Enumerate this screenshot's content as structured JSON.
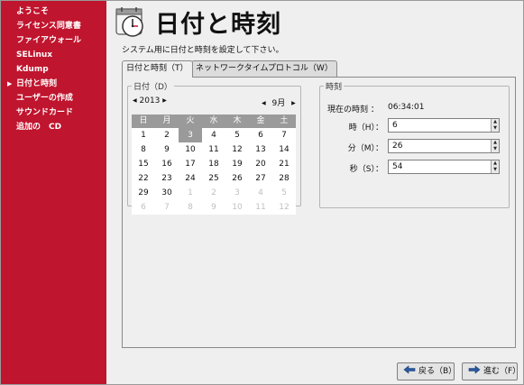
{
  "sidebar": {
    "items": [
      {
        "label": "ようこそ",
        "current": false
      },
      {
        "label": "ライセンス同意書",
        "current": false
      },
      {
        "label": "ファイアウォール",
        "current": false
      },
      {
        "label": "SELinux",
        "current": false
      },
      {
        "label": "Kdump",
        "current": false
      },
      {
        "label": "日付と時刻",
        "current": true
      },
      {
        "label": "ユーザーの作成",
        "current": false
      },
      {
        "label": "サウンドカード",
        "current": false
      },
      {
        "label": "追加の　CD",
        "current": false
      }
    ]
  },
  "page": {
    "title": "日付と時刻",
    "subtitle": "システム用に日付と時刻を設定して下さい。"
  },
  "tabs": [
    {
      "label": "日付と時刻（T）",
      "active": true
    },
    {
      "label": "ネットワークタイムプロトコル（W）",
      "active": false
    }
  ],
  "calendar": {
    "group_title": "日付（D）",
    "year": "2013",
    "month": "9月",
    "weekdays": [
      "日",
      "月",
      "火",
      "水",
      "木",
      "金",
      "土"
    ],
    "selected_day": "3",
    "weeks": [
      [
        {
          "d": "1"
        },
        {
          "d": "2"
        },
        {
          "d": "3",
          "sel": true
        },
        {
          "d": "4"
        },
        {
          "d": "5"
        },
        {
          "d": "6"
        },
        {
          "d": "7"
        }
      ],
      [
        {
          "d": "8"
        },
        {
          "d": "9"
        },
        {
          "d": "10"
        },
        {
          "d": "11"
        },
        {
          "d": "12"
        },
        {
          "d": "13"
        },
        {
          "d": "14"
        }
      ],
      [
        {
          "d": "15"
        },
        {
          "d": "16"
        },
        {
          "d": "17"
        },
        {
          "d": "18"
        },
        {
          "d": "19"
        },
        {
          "d": "20"
        },
        {
          "d": "21"
        }
      ],
      [
        {
          "d": "22"
        },
        {
          "d": "23"
        },
        {
          "d": "24"
        },
        {
          "d": "25"
        },
        {
          "d": "26"
        },
        {
          "d": "27"
        },
        {
          "d": "28"
        }
      ],
      [
        {
          "d": "29"
        },
        {
          "d": "30"
        },
        {
          "d": "1",
          "dim": true
        },
        {
          "d": "2",
          "dim": true
        },
        {
          "d": "3",
          "dim": true
        },
        {
          "d": "4",
          "dim": true
        },
        {
          "d": "5",
          "dim": true
        }
      ],
      [
        {
          "d": "6",
          "dim": true
        },
        {
          "d": "7",
          "dim": true
        },
        {
          "d": "8",
          "dim": true
        },
        {
          "d": "9",
          "dim": true
        },
        {
          "d": "10",
          "dim": true
        },
        {
          "d": "11",
          "dim": true
        },
        {
          "d": "12",
          "dim": true
        }
      ]
    ]
  },
  "time": {
    "group_title": "時刻",
    "current_label": "現在の時刻 ：",
    "current_value": "06:34:01",
    "hour_label": "時（H）：",
    "hour_value": "6",
    "minute_label": "分（M）：",
    "minute_value": "26",
    "second_label": "秒（S）：",
    "second_value": "54"
  },
  "buttons": {
    "back": "戻る（B）",
    "next": "進む（F）"
  },
  "colors": {
    "sidebar": "#c0152e",
    "main_bg": "#efefef",
    "calendar_header": "#9a9a9a"
  }
}
